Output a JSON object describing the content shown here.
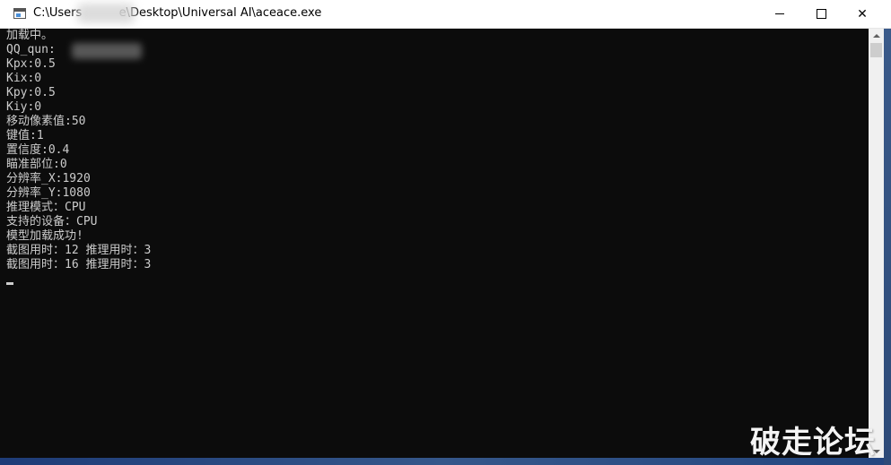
{
  "window": {
    "title": "C:\\Users          e\\Desktop\\Universal AI\\aceace.exe",
    "controls": {
      "minimize": "—",
      "maximize": "☐",
      "close": "✕"
    }
  },
  "console": {
    "lines": [
      "加载中。",
      "QQ_qun:",
      "Kpx:0.5",
      "Kix:0",
      "Kpy:0.5",
      "Kiy:0",
      "移动像素值:50",
      "键值:1",
      "置信度:0.4",
      "瞄准部位:0",
      "分辨率_X:1920",
      "分辨率_Y:1080",
      "推理模式：CPU",
      "支持的设备：CPU",
      "模型加载成功!",
      "截图用时：12 推理用时：3",
      "截图用时：16 推理用时：3"
    ]
  },
  "watermark": {
    "text": "破走论坛"
  },
  "colors": {
    "console_bg": "#0c0c0c",
    "console_text": "#cccccc",
    "titlebar_bg": "#ffffff",
    "scrollbar_bg": "#f0f0f0"
  },
  "icons": {
    "app": "console-app-icon",
    "minimize": "minimize-icon",
    "maximize": "maximize-icon",
    "close": "close-icon",
    "scroll_up": "scroll-up-arrow-icon",
    "scroll_down": "scroll-down-arrow-icon"
  }
}
